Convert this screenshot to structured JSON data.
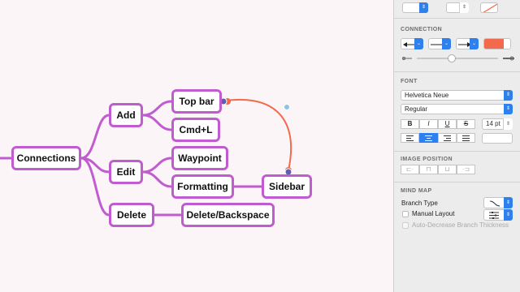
{
  "mindmap": {
    "nodes": {
      "connections": "Connections",
      "add": "Add",
      "edit": "Edit",
      "delete": "Delete",
      "top_bar": "Top bar",
      "cmd_l": "Cmd+L",
      "waypoint": "Waypoint",
      "formatting": "Formatting",
      "sidebar": "Sidebar",
      "delete_backspace": "Delete/Backspace"
    }
  },
  "inspector": {
    "connection": {
      "title": "CONNECTION",
      "color": "#f26a4b"
    },
    "font": {
      "title": "FONT",
      "family": "Helvetica Neue",
      "style": "Regular",
      "bold": "B",
      "italic": "I",
      "underline": "U",
      "strike": "S",
      "size": "14 pt"
    },
    "image_position": {
      "title": "IMAGE POSITION"
    },
    "mind_map": {
      "title": "MIND MAP",
      "branch_type_label": "Branch Type",
      "manual_layout_label": "Manual Layout",
      "auto_decrease_label": "Auto-Decrease Branch Thickness"
    }
  },
  "colors": {
    "node_border": "#c05ccf",
    "connection": "#f26a4b",
    "accent": "#2f80ed"
  }
}
